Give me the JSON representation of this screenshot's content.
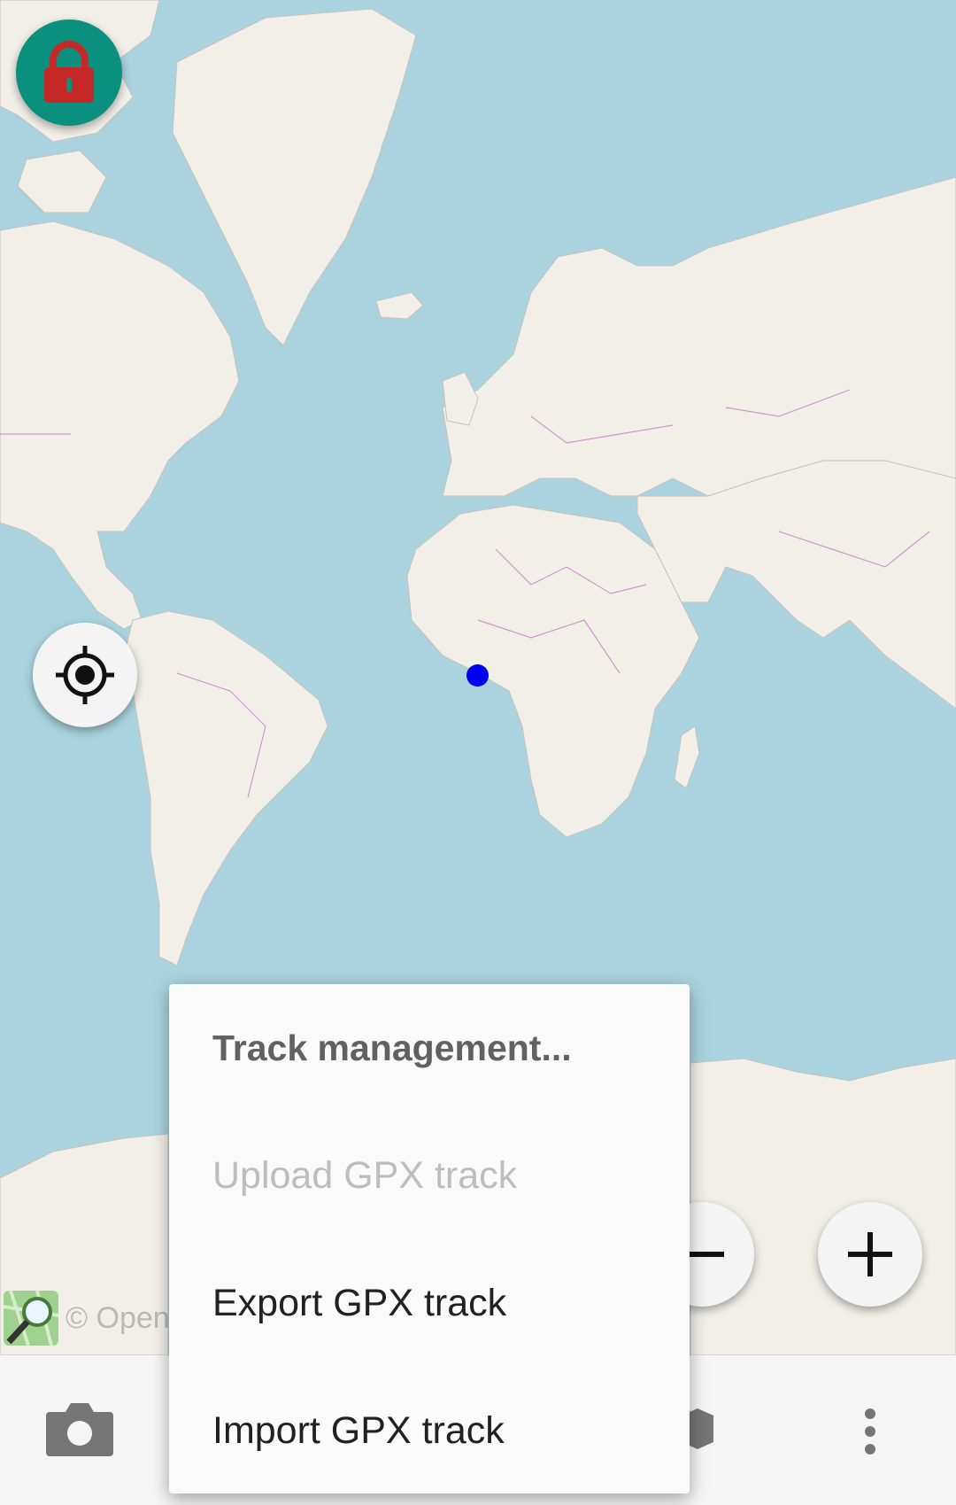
{
  "map": {
    "attribution": "© Open",
    "gps_marker_color": "#0000f0",
    "water_color": "#aad3df",
    "land_color": "#f2efe9",
    "border_color": "#c77fc7"
  },
  "controls": {
    "lock": {
      "icon": "lock-icon",
      "accent": "#0b8f7e"
    },
    "locate": {
      "icon": "crosshair-icon"
    },
    "zoom_out": {
      "icon": "minus-icon"
    },
    "zoom_in": {
      "icon": "plus-icon"
    }
  },
  "bottom_bar": {
    "items": [
      {
        "icon": "camera-icon"
      },
      {
        "icon": "settings-icon"
      },
      {
        "icon": "more-vert-icon"
      }
    ]
  },
  "menu": {
    "title": "Track management...",
    "items": [
      {
        "label": "Upload GPX track",
        "enabled": false
      },
      {
        "label": "Export GPX track",
        "enabled": true
      },
      {
        "label": "Import GPX track",
        "enabled": true
      }
    ]
  }
}
